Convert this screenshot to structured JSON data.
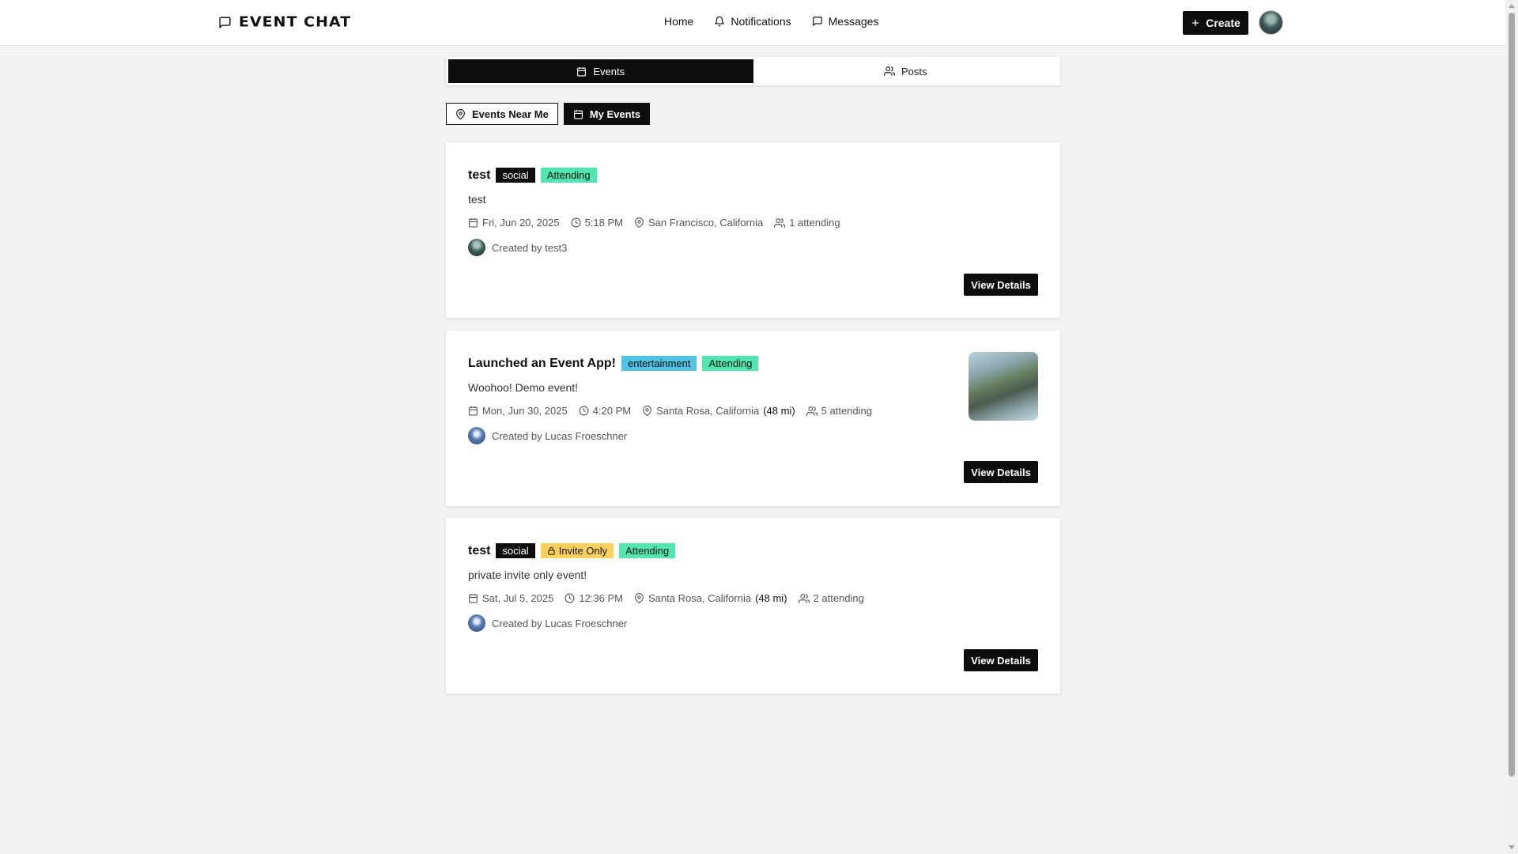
{
  "header": {
    "logo_text": "EVENT CHAT",
    "nav": {
      "home": "Home",
      "notifications": "Notifications",
      "messages": "Messages"
    },
    "create_label": "Create"
  },
  "tabs": {
    "events": "Events",
    "posts": "Posts",
    "active": "events"
  },
  "filters": {
    "near_me": "Events Near Me",
    "my_events": "My Events",
    "active": "my_events"
  },
  "events": [
    {
      "title": "test",
      "badges": [
        "social",
        "Attending"
      ],
      "description": "test",
      "date": "Fri, Jun 20, 2025",
      "time": "5:18 PM",
      "location": "San Francisco, California",
      "distance": "",
      "attending": "1 attending",
      "creator": "Created by test3",
      "button": "View Details"
    },
    {
      "title": "Launched an Event App!",
      "badges": [
        "entertainment",
        "Attending"
      ],
      "description": "Woohoo! Demo event!",
      "date": "Mon, Jun 30, 2025",
      "time": "4:20 PM",
      "location": "Santa Rosa, California",
      "distance": "(48 mi)",
      "attending": "5 attending",
      "creator": "Created by Lucas Froeschner",
      "button": "View Details"
    },
    {
      "title": "test",
      "badges": [
        "social",
        "Invite Only",
        "Attending"
      ],
      "description": "private invite only event!",
      "date": "Sat, Jul 5, 2025",
      "time": "12:36 PM",
      "location": "Santa Rosa, California",
      "distance": "(48 mi)",
      "attending": "2 attending",
      "creator": "Created by Lucas Froeschner",
      "button": "View Details"
    }
  ],
  "colors": {
    "primary": "#0d0d0d",
    "attending_badge": "#4ee7b0",
    "entertainment_badge": "#4ec3e3",
    "invite_only_badge": "#fbd15a",
    "background": "#f2f2f2"
  }
}
